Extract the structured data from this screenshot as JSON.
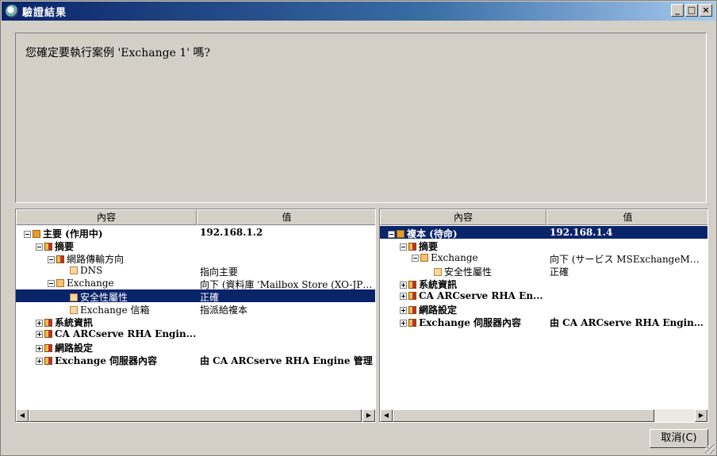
{
  "window": {
    "title": "驗證結果",
    "min_label": "_",
    "max_label": "□",
    "close_label": "×"
  },
  "prompt": {
    "message": "您確定要執行案例 'Exchange 1' 嗎?"
  },
  "left_panel": {
    "columns": [
      "內容",
      "值"
    ],
    "rows": [
      {
        "label": "主要 (作用中)",
        "value": "192.168.1.2",
        "bold": true,
        "indent": 0,
        "expander": "minus",
        "icon": "server-icon",
        "selected": false
      },
      {
        "label": "摘要",
        "value": "",
        "bold": true,
        "indent": 1,
        "expander": "minus",
        "icon": "summary-icon",
        "selected": false
      },
      {
        "label": "網路傳輸方向",
        "value": "",
        "bold": false,
        "indent": 2,
        "expander": "minus",
        "icon": "network-direction-icon",
        "selected": false
      },
      {
        "label": "DNS",
        "value": "指向主要",
        "bold": false,
        "indent": 3,
        "expander": "none",
        "icon": "property-icon",
        "selected": false
      },
      {
        "label": "Exchange",
        "value": "向下 (資料庫 'Mailbox Store (XO-JPN-SP...",
        "bold": false,
        "indent": 2,
        "expander": "minus",
        "icon": "node-icon",
        "selected": false
      },
      {
        "label": "安全性屬性",
        "value": "正確",
        "bold": false,
        "indent": 3,
        "expander": "none",
        "icon": "property-icon",
        "selected": true
      },
      {
        "label": "Exchange 信箱",
        "value": "指派給複本",
        "bold": false,
        "indent": 3,
        "expander": "none",
        "icon": "property-icon",
        "selected": false
      },
      {
        "label": "系統資訊",
        "value": "",
        "bold": true,
        "indent": 1,
        "expander": "plus",
        "icon": "summary-icon",
        "selected": false
      },
      {
        "label": "CA ARCserve RHA Engin...",
        "value": "",
        "bold": true,
        "indent": 1,
        "expander": "plus",
        "icon": "summary-icon",
        "selected": false
      },
      {
        "label": "網路設定",
        "value": "",
        "bold": true,
        "indent": 1,
        "expander": "plus",
        "icon": "summary-icon",
        "selected": false
      },
      {
        "label": "Exchange 伺服器內容",
        "value": "由 CA ARCserve RHA Engine 管理",
        "bold": true,
        "indent": 1,
        "expander": "plus",
        "icon": "summary-icon",
        "selected": false
      }
    ]
  },
  "right_panel": {
    "columns": [
      "內容",
      "值"
    ],
    "rows": [
      {
        "label": "複本 (待命)",
        "value": "192.168.1.4",
        "bold": true,
        "indent": 0,
        "expander": "minus",
        "icon": "server-icon",
        "selected": true
      },
      {
        "label": "摘要",
        "value": "",
        "bold": true,
        "indent": 1,
        "expander": "minus",
        "icon": "summary-icon",
        "selected": false
      },
      {
        "label": "Exchange",
        "value": "向下 (サービス MSExchangeMGMT ...",
        "bold": false,
        "indent": 2,
        "expander": "minus",
        "icon": "node-icon",
        "selected": false
      },
      {
        "label": "安全性屬性",
        "value": "正確",
        "bold": false,
        "indent": 3,
        "expander": "none",
        "icon": "property-icon",
        "selected": false
      },
      {
        "label": "系統資訊",
        "value": "",
        "bold": true,
        "indent": 1,
        "expander": "plus",
        "icon": "summary-icon",
        "selected": false
      },
      {
        "label": "CA ARCserve RHA En...",
        "value": "",
        "bold": true,
        "indent": 1,
        "expander": "plus",
        "icon": "summary-icon",
        "selected": false
      },
      {
        "label": "網路設定",
        "value": "",
        "bold": true,
        "indent": 1,
        "expander": "plus",
        "icon": "summary-icon",
        "selected": false
      },
      {
        "label": "Exchange 伺服器內容",
        "value": "由 CA ARCserve RHA Engine ...",
        "bold": true,
        "indent": 1,
        "expander": "plus",
        "icon": "summary-icon",
        "selected": false
      }
    ]
  },
  "footer": {
    "cancel_label": "取消(C)"
  }
}
